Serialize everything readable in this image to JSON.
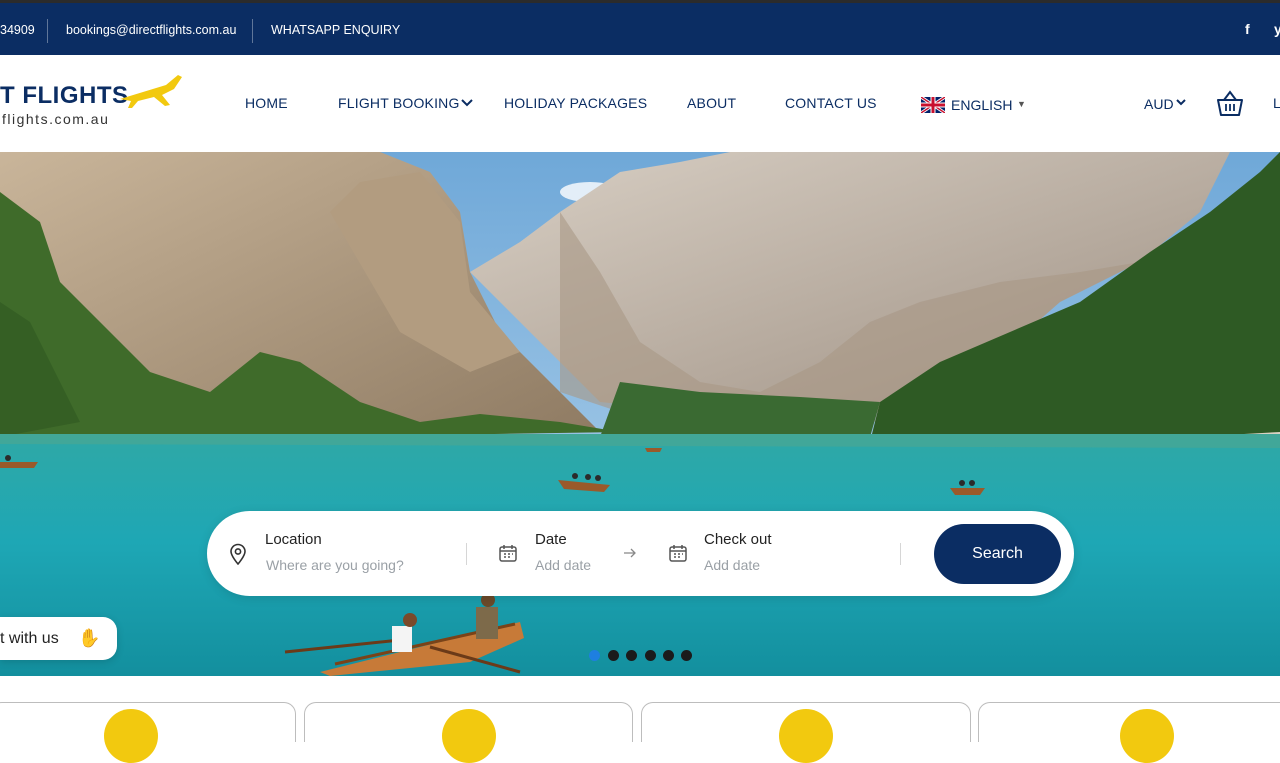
{
  "topbar": {
    "phone": "34909",
    "email": "bookings@directflights.com.au",
    "whatsapp": "WHATSAPP ENQUIRY",
    "social": [
      "facebook-icon",
      "twitter-icon"
    ],
    "background": "#0b2d63"
  },
  "logo": {
    "name": "T FLIGHTS",
    "sub": "flights.com.au"
  },
  "nav": {
    "home": "HOME",
    "flight_booking": "FLIGHT BOOKING",
    "holiday_packages": "HOLIDAY PACKAGES",
    "about": "ABOUT",
    "contact": "CONTACT US",
    "language": "ENGLISH",
    "currency": "AUD",
    "login_stub": "L"
  },
  "search": {
    "location_label": "Location",
    "location_placeholder": "Where are you going?",
    "date_label": "Date",
    "date_placeholder": "Add date",
    "checkout_label": "Check out",
    "checkout_placeholder": "Add date",
    "button": "Search"
  },
  "chat": {
    "label": "t with us"
  },
  "carousel": {
    "slides": 6,
    "active": 1
  },
  "colors": {
    "brand": "#0b2d63",
    "accent": "#f2c90f",
    "active_dot": "#1e7fe0"
  }
}
